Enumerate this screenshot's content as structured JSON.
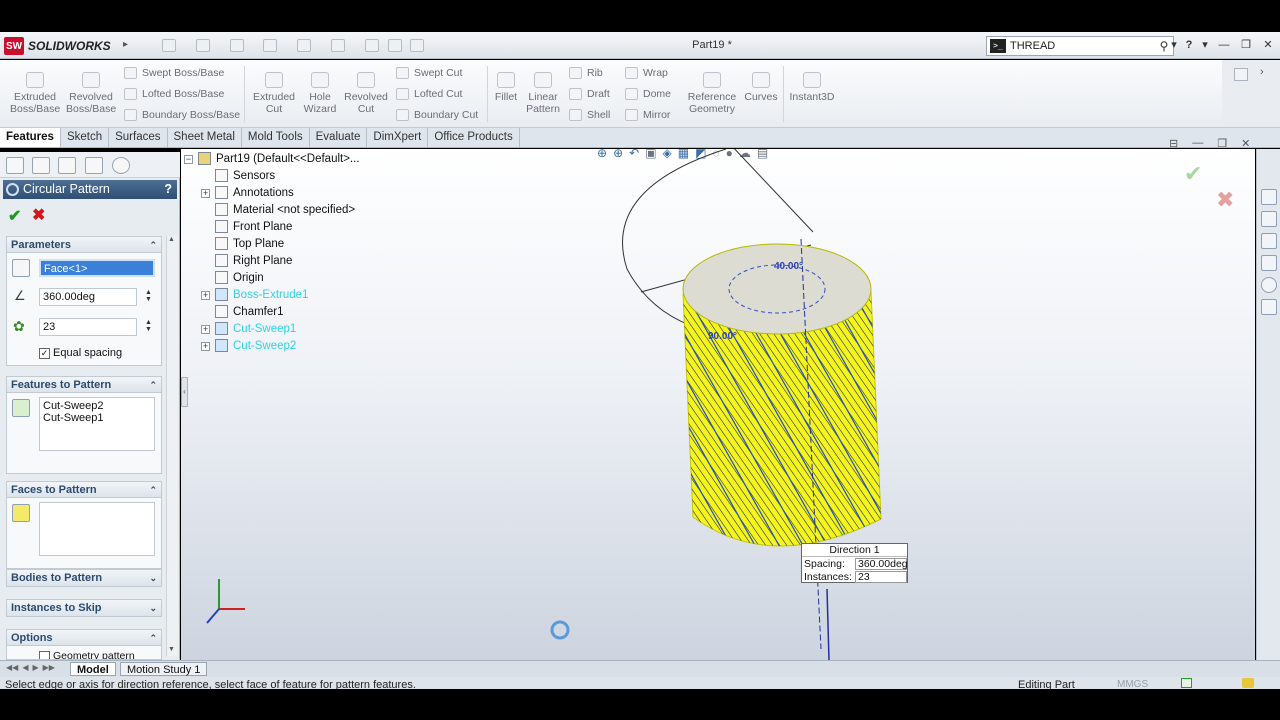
{
  "app": {
    "brand": "SOLIDWORKS",
    "document_title": "Part19 *",
    "search_value": "THREAD",
    "help_icon": "question-icon"
  },
  "command_manager": {
    "big_tools": [
      "Extruded Boss/Base",
      "Revolved Boss/Base",
      "Extruded Cut",
      "Hole Wizard",
      "Revolved Cut",
      "Fillet",
      "Linear Pattern",
      "Reference Geometry",
      "Curves",
      "Instant3D"
    ],
    "boss_small": [
      "Swept Boss/Base",
      "Lofted Boss/Base",
      "Boundary Boss/Base"
    ],
    "cut_small": [
      "Swept Cut",
      "Lofted Cut",
      "Boundary Cut"
    ],
    "features_small": [
      "Rib",
      "Wrap",
      "Draft",
      "Dome",
      "Shell",
      "Mirror"
    ]
  },
  "tabs": [
    "Features",
    "Sketch",
    "Surfaces",
    "Sheet Metal",
    "Mold Tools",
    "Evaluate",
    "DimXpert",
    "Office Products"
  ],
  "property_manager": {
    "title": "Circular Pattern",
    "help": "?",
    "parameters": {
      "header": "Parameters",
      "axis_value": "Face<1>",
      "angle_value": "360.00deg",
      "instances_value": "23",
      "equal_spacing_label": "Equal spacing",
      "equal_spacing_checked": true
    },
    "features_to_pattern": {
      "header": "Features to Pattern",
      "items": [
        "Cut-Sweep2",
        "Cut-Sweep1"
      ]
    },
    "faces_to_pattern": {
      "header": "Faces to Pattern"
    },
    "bodies_to_pattern": {
      "header": "Bodies to Pattern"
    },
    "instances_to_skip": {
      "header": "Instances to Skip"
    },
    "options": {
      "header": "Options",
      "first_item": "Geometry pattern"
    }
  },
  "feature_tree": {
    "root": "Part19  (Default<<Default>...",
    "items": [
      {
        "label": "Sensors",
        "ghost": false,
        "expand": false
      },
      {
        "label": "Annotations",
        "ghost": false,
        "expand": true
      },
      {
        "label": "Material <not specified>",
        "ghost": false,
        "expand": false
      },
      {
        "label": "Front Plane",
        "ghost": false,
        "expand": false
      },
      {
        "label": "Top Plane",
        "ghost": false,
        "expand": false
      },
      {
        "label": "Right Plane",
        "ghost": false,
        "expand": false
      },
      {
        "label": "Origin",
        "ghost": false,
        "expand": false
      },
      {
        "label": "Boss-Extrude1",
        "ghost": true,
        "expand": true
      },
      {
        "label": "Chamfer1",
        "ghost": false,
        "expand": false
      },
      {
        "label": "Cut-Sweep1",
        "ghost": true,
        "expand": true
      },
      {
        "label": "Cut-Sweep2",
        "ghost": true,
        "expand": true
      }
    ]
  },
  "viewport": {
    "model_color": "#f5f51e",
    "dimension_1": "40.00°",
    "dimension_2": "90.00°",
    "callout": {
      "title": "Direction 1",
      "spacing_label": "Spacing:",
      "spacing_value": "360.00deg",
      "instances_label": "Instances:",
      "instances_value": "23"
    }
  },
  "bottom_tabs": [
    "Model",
    "Motion Study 1"
  ],
  "status": {
    "message": "Select edge or axis for direction reference, select face of feature for pattern features.",
    "mode": "Editing Part",
    "units": "MMGS"
  }
}
